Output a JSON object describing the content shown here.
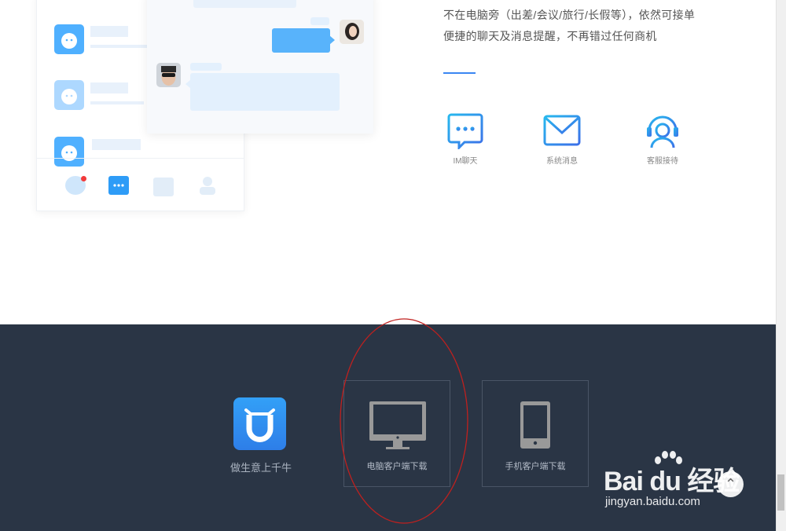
{
  "intro": {
    "line1": "不在电脑旁（出差/会议/旅行/长假等），依然可接单",
    "line2": "便捷的聊天及消息提醒，不再错过任何商机"
  },
  "features": [
    {
      "label": "IM聊天",
      "icon": "chat-dots-icon"
    },
    {
      "label": "系统消息",
      "icon": "envelope-icon"
    },
    {
      "label": "客服接待",
      "icon": "headset-icon"
    }
  ],
  "footer": {
    "app_name": "做生意上千牛",
    "downloads": [
      {
        "label": "电脑客户端下载",
        "icon": "monitor-icon"
      },
      {
        "label": "手机客户端下载",
        "icon": "tablet-icon"
      }
    ]
  },
  "watermark": {
    "brand": "Bai du 经验",
    "url": "jingyan.baidu.com"
  },
  "colors": {
    "footer_bg": "#2a3545",
    "accent": "#3a86f2",
    "annotation": "#c0201e"
  }
}
